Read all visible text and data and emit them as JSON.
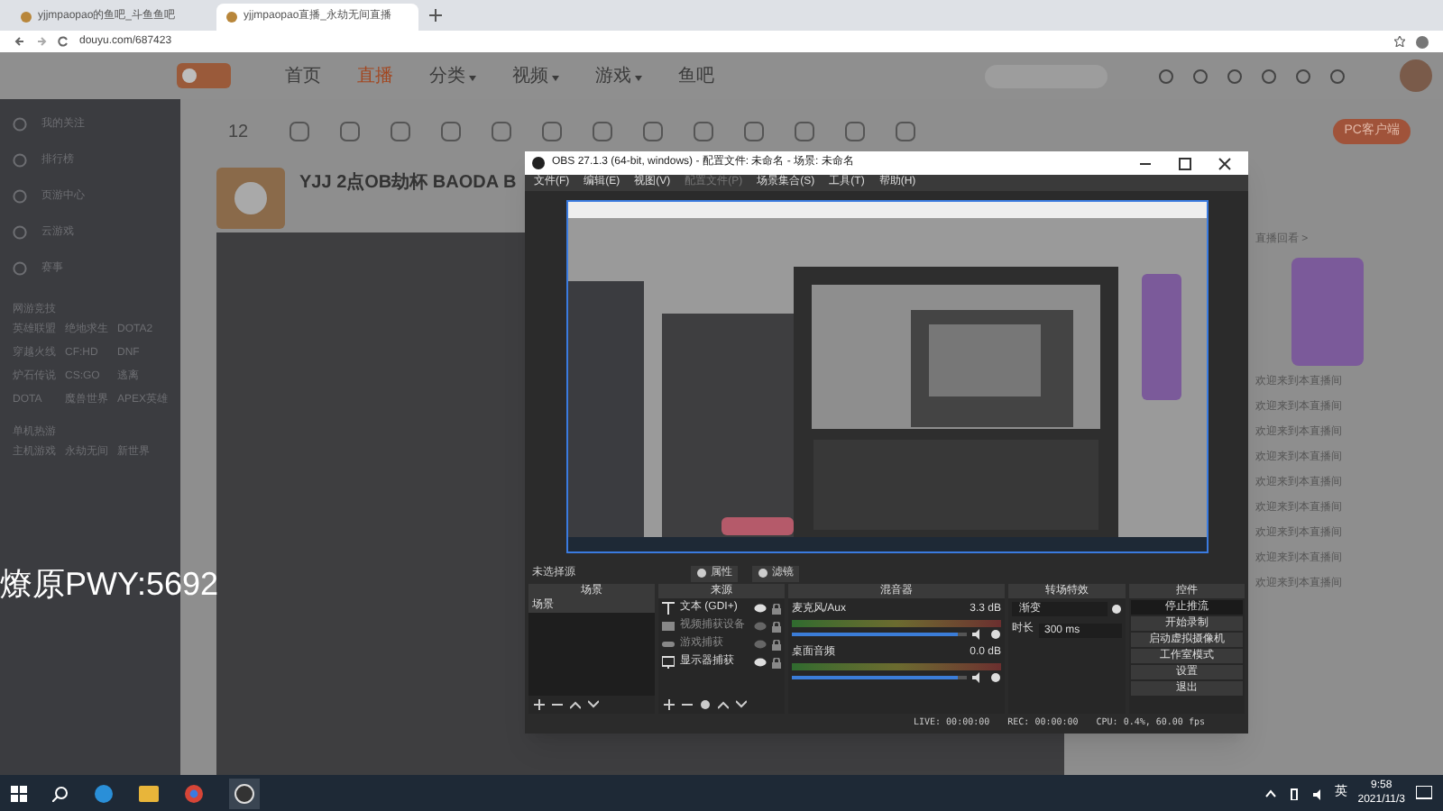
{
  "browser": {
    "tabs": [
      {
        "title": "yjjmpaopao的鱼吧_斗鱼鱼吧",
        "selected": false
      },
      {
        "title": "yjjmpaopao直播_永劫无间直播",
        "selected": true
      }
    ],
    "url": "douyu.com/687423"
  },
  "site": {
    "nav": [
      {
        "label": "首页",
        "selected": false,
        "caret": false
      },
      {
        "label": "直播",
        "selected": true,
        "caret": false
      },
      {
        "label": "分类",
        "selected": false,
        "caret": true
      },
      {
        "label": "视频",
        "selected": false,
        "caret": true
      },
      {
        "label": "游戏",
        "selected": false,
        "caret": true
      },
      {
        "label": "鱼吧",
        "selected": false,
        "caret": false
      }
    ],
    "follow_count": "12",
    "client_button": "PC客户端",
    "sidebar": {
      "items": [
        "我的关注",
        "排行榜",
        "页游中心",
        "云游戏",
        "赛事"
      ],
      "sections": [
        {
          "title": "网游竞技",
          "games": [
            "英雄联盟",
            "绝地求生",
            "DOTA2",
            "穿越火线",
            "CF:HD",
            "DNF",
            "炉石传说",
            "CS:GO",
            "逃离",
            "DOTA",
            "魔兽世界",
            "APEX英雄"
          ]
        },
        {
          "title": "单机热游",
          "games": [
            "主机游戏",
            "永劫无间",
            "新世界"
          ]
        }
      ]
    },
    "room_title": "YJJ 2点OB劫杯 BAODA B",
    "replay": "直播回看 >",
    "chat": [
      "欢迎来到本直播间",
      "欢迎来到本直播间",
      "欢迎来到本直播间",
      "欢迎来到本直播间",
      "欢迎来到本直播间",
      "欢迎来到本直播间",
      "欢迎来到本直播间",
      "欢迎来到本直播间",
      "欢迎来到本直播间"
    ],
    "overlay_text": "燎原PWY:5692"
  },
  "obs": {
    "title": "OBS 27.1.3 (64-bit, windows) - 配置文件: 未命名 - 场景: 未命名",
    "menu": [
      {
        "label": "文件(F)",
        "disabled": false
      },
      {
        "label": "编辑(E)",
        "disabled": false
      },
      {
        "label": "视图(V)",
        "disabled": false
      },
      {
        "label": "配置文件(P)",
        "disabled": true
      },
      {
        "label": "场景集合(S)",
        "disabled": false
      },
      {
        "label": "工具(T)",
        "disabled": false
      },
      {
        "label": "帮助(H)",
        "disabled": false
      }
    ],
    "preview": {
      "kind": "picture"
    },
    "source_bar": {
      "label": "未选择源",
      "buttons": [
        "属性",
        "滤镜"
      ]
    },
    "docks": [
      "场景",
      "来源",
      "混音器",
      "转场特效",
      "控件"
    ],
    "scenes": [
      {
        "name": "场景",
        "selected": true
      }
    ],
    "sources": [
      {
        "kind": "text",
        "name": "文本 (GDI+)",
        "visible": true
      },
      {
        "kind": "camera",
        "name": "视频捕获设备",
        "visible": false
      },
      {
        "kind": "game",
        "name": "游戏捕获",
        "visible": false
      },
      {
        "kind": "monitor",
        "name": "显示器捕获",
        "visible": true
      }
    ],
    "mixer": [
      {
        "name": "麦克风/Aux",
        "reading": "3.3 dB",
        "level": 0.95
      },
      {
        "name": "桌面音频",
        "reading": "0.0 dB",
        "level": 0.95
      }
    ],
    "transition": {
      "value": "渐变",
      "duration_label": "时长",
      "duration": "300 ms"
    },
    "controls": [
      {
        "label": "停止推流",
        "active": true
      },
      {
        "label": "开始录制",
        "active": false
      },
      {
        "label": "启动虚拟摄像机",
        "active": false
      },
      {
        "label": "工作室模式",
        "active": false
      },
      {
        "label": "设置",
        "active": false
      },
      {
        "label": "退出",
        "active": false
      }
    ],
    "status": [
      "LIVE: 00:00:00",
      "REC: 00:00:00",
      "CPU: 0.4%, 60.00 fps"
    ]
  },
  "taskbar": {
    "ime": "英",
    "time": "9:58",
    "date": "2021/11/3"
  }
}
